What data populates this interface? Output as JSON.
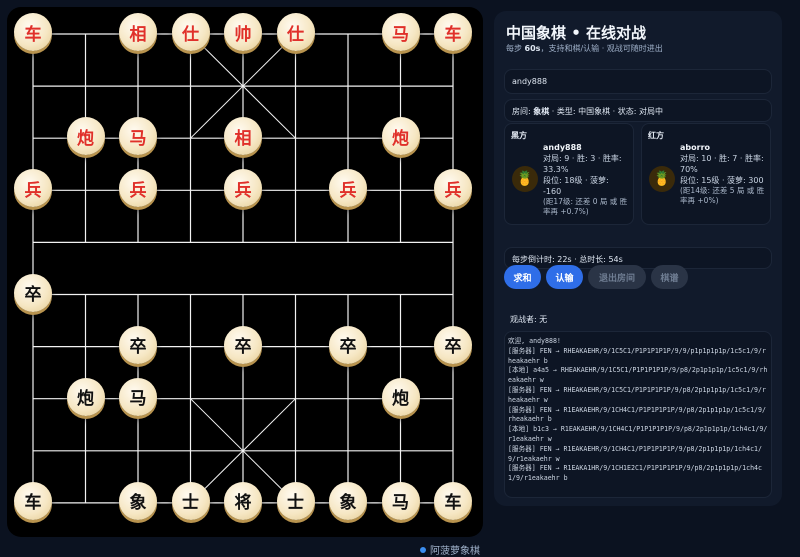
{
  "panel": {
    "title": "中国象棋 • 在线对战",
    "subtitle_prefix": "每步 ",
    "subtitle_step": "60s",
    "subtitle_rest": "，支持和棋/认输 · 观战可随时进出",
    "username": "andy888",
    "room_prefix": "房间: ",
    "room_name": "象棋",
    "room_rest": " · 类型: 中国象棋 · 状态: 对局中",
    "black": {
      "side": "黑方",
      "name": "andy888",
      "line1": "对局: 9 · 胜: 3 · 胜率: 33.3%",
      "line2": "段位: 18级 · 菠萝: -160",
      "note": "(距17级: 还差 0 局 或 胜率再 +0.7%)"
    },
    "red": {
      "side": "红方",
      "name": "aborro",
      "line1": "对局: 10 · 胜: 7 · 胜率: 70%",
      "line2": "段位: 15级 · 菠萝: 300",
      "note": "(距14级: 还差 5 局 或 胜率再 +0%)"
    },
    "timer": "每步倒计时: 22s · 总时长: 54s",
    "buttons": {
      "draw": "求和",
      "resign": "认输",
      "leave": "退出房间",
      "record": "棋谱"
    },
    "spectators": "观战者: 无",
    "log": [
      "欢迎, andy888!",
      "[服务器] FEN → RHEAKAEHR/9/1C5C1/P1P1P1P1P/9/9/p1p1p1p1p/1c5c1/9/rheakaehr b",
      "[本地] a4a5 → RHEAKAEHR/9/1C5C1/P1P1P1P1P/9/p8/2p1p1p1p/1c5c1/9/rheakaehr w",
      "[服务器] FEN → RHEAKAEHR/9/1C5C1/P1P1P1P1P/9/p8/2p1p1p1p/1c5c1/9/rheakaehr w",
      "[服务器] FEN → R1EAKAEHR/9/1CH4C1/P1P1P1P1P/9/p8/2p1p1p1p/1c5c1/9/rheakaehr b",
      "[本地] b1c3 → R1EAKAEHR/9/1CH4C1/P1P1P1P1P/9/p8/2p1p1p1p/1ch4c1/9/r1eakaehr w",
      "[服务器] FEN → R1EAKAEHR/9/1CH4C1/P1P1P1P1P/9/p8/2p1p1p1p/1ch4c1/9/r1eakaehr w",
      "[服务器] FEN → R1EAKA1HR/9/1CH1E2C1/P1P1P1P1P/9/p8/2p1p1p1p/1ch4c1/9/r1eakaehr b"
    ]
  },
  "brand": "阿菠萝象棋",
  "board": {
    "pieces": [
      {
        "col": 0,
        "row": 0,
        "char": "车",
        "color": "red"
      },
      {
        "col": 2,
        "row": 0,
        "char": "相",
        "color": "red"
      },
      {
        "col": 3,
        "row": 0,
        "char": "仕",
        "color": "red"
      },
      {
        "col": 4,
        "row": 0,
        "char": "帅",
        "color": "red"
      },
      {
        "col": 5,
        "row": 0,
        "char": "仕",
        "color": "red"
      },
      {
        "col": 7,
        "row": 0,
        "char": "马",
        "color": "red"
      },
      {
        "col": 8,
        "row": 0,
        "char": "车",
        "color": "red"
      },
      {
        "col": 1,
        "row": 2,
        "char": "炮",
        "color": "red"
      },
      {
        "col": 2,
        "row": 2,
        "char": "马",
        "color": "red"
      },
      {
        "col": 4,
        "row": 2,
        "char": "相",
        "color": "red"
      },
      {
        "col": 7,
        "row": 2,
        "char": "炮",
        "color": "red"
      },
      {
        "col": 0,
        "row": 3,
        "char": "兵",
        "color": "red"
      },
      {
        "col": 2,
        "row": 3,
        "char": "兵",
        "color": "red"
      },
      {
        "col": 4,
        "row": 3,
        "char": "兵",
        "color": "red"
      },
      {
        "col": 6,
        "row": 3,
        "char": "兵",
        "color": "red"
      },
      {
        "col": 8,
        "row": 3,
        "char": "兵",
        "color": "red"
      },
      {
        "col": 0,
        "row": 5,
        "char": "卒",
        "color": "black"
      },
      {
        "col": 2,
        "row": 6,
        "char": "卒",
        "color": "black"
      },
      {
        "col": 4,
        "row": 6,
        "char": "卒",
        "color": "black"
      },
      {
        "col": 6,
        "row": 6,
        "char": "卒",
        "color": "black"
      },
      {
        "col": 8,
        "row": 6,
        "char": "卒",
        "color": "black"
      },
      {
        "col": 1,
        "row": 7,
        "char": "炮",
        "color": "black"
      },
      {
        "col": 2,
        "row": 7,
        "char": "马",
        "color": "black"
      },
      {
        "col": 7,
        "row": 7,
        "char": "炮",
        "color": "black"
      },
      {
        "col": 0,
        "row": 9,
        "char": "车",
        "color": "black"
      },
      {
        "col": 2,
        "row": 9,
        "char": "象",
        "color": "black"
      },
      {
        "col": 3,
        "row": 9,
        "char": "士",
        "color": "black"
      },
      {
        "col": 4,
        "row": 9,
        "char": "将",
        "color": "black"
      },
      {
        "col": 5,
        "row": 9,
        "char": "士",
        "color": "black"
      },
      {
        "col": 6,
        "row": 9,
        "char": "象",
        "color": "black"
      },
      {
        "col": 7,
        "row": 9,
        "char": "马",
        "color": "black"
      },
      {
        "col": 8,
        "row": 9,
        "char": "车",
        "color": "black"
      }
    ]
  }
}
